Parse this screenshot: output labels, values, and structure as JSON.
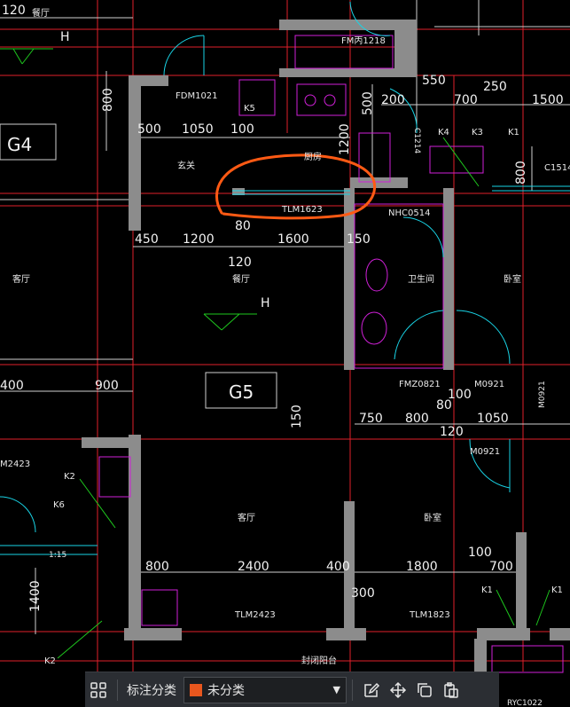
{
  "drawing": {
    "dims": [
      "120",
      "800",
      "500",
      "1050",
      "100",
      "200",
      "550",
      "700",
      "250",
      "1500",
      "500",
      "1200",
      "800",
      "450",
      "1200",
      "80",
      "1600",
      "150",
      "120",
      "400",
      "900",
      "150",
      "750",
      "800",
      "80",
      "100",
      "1050",
      "120",
      "800",
      "2400",
      "400",
      "1800",
      "100",
      "700",
      "1400",
      "300"
    ],
    "labels": {
      "fm1218": "FM丙1218",
      "fdm1021": "FDM1021",
      "k5": "K5",
      "entrance": "玄关",
      "kitchen": "厨房",
      "tlm1623": "TLM1623",
      "nhc0514": "NHC0514",
      "c1214": "C1214",
      "k4": "K4",
      "k3": "K3",
      "k1a": "K1",
      "c1514": "C1514",
      "living_g4": "客厅",
      "h_top": "H",
      "restaurant": "餐厅",
      "h_mid": "H",
      "bathroom": "卫生间",
      "bedroom_top": "卧室",
      "g4": "G4",
      "g5": "G5",
      "fmz0821": "FMZ0821",
      "m0921a": "M0921",
      "m0921b": "M0921",
      "m0921v": "M0921",
      "m2423": "M2423",
      "k2a": "K2",
      "k6": "K6",
      "one_fifteen": "1:15",
      "living_g5": "客厅",
      "bedroom_g5": "卧室",
      "tlm2423": "TLM2423",
      "tlm1823": "TLM1823",
      "k1b": "K1",
      "k1c": "K1",
      "k2b": "K2",
      "balcony": "封闭阳台",
      "ryc1022": "RYC1022",
      "top_living": "餐厅"
    }
  },
  "toolbar": {
    "grid_icon": "grid-icon",
    "label": "标注分类",
    "select_value": "未分类",
    "select_color": "#e8571e",
    "edit_icon": "edit-icon",
    "move_icon": "move-icon",
    "copy_icon": "copy-icon",
    "paste_icon": "paste-icon"
  }
}
